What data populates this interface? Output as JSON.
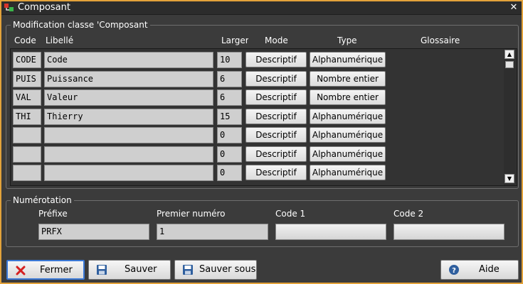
{
  "window": {
    "title": "Composant"
  },
  "grid_group": {
    "title": "Modification classe 'Composant"
  },
  "columns": {
    "code": "Code",
    "libelle": "Libellé",
    "largeur": "Larger",
    "mode": "Mode",
    "type": "Type",
    "glossaire": "Glossaire"
  },
  "rows": [
    {
      "code": "CODE",
      "libelle": "Code",
      "largeur": "10",
      "mode": "Descriptif",
      "type": "Alphanumérique"
    },
    {
      "code": "PUIS",
      "libelle": "Puissance",
      "largeur": "6",
      "mode": "Descriptif",
      "type": "Nombre entier"
    },
    {
      "code": "VAL",
      "libelle": "Valeur",
      "largeur": "6",
      "mode": "Descriptif",
      "type": "Nombre entier"
    },
    {
      "code": "THI",
      "libelle": "Thierry",
      "largeur": "15",
      "mode": "Descriptif",
      "type": "Alphanumérique"
    },
    {
      "code": "",
      "libelle": "",
      "largeur": "0",
      "mode": "Descriptif",
      "type": "Alphanumérique"
    },
    {
      "code": "",
      "libelle": "",
      "largeur": "0",
      "mode": "Descriptif",
      "type": "Alphanumérique"
    },
    {
      "code": "",
      "libelle": "",
      "largeur": "0",
      "mode": "Descriptif",
      "type": "Alphanumérique"
    }
  ],
  "numerotation": {
    "title": "Numérotation",
    "prefixe_label": "Préfixe",
    "prefixe_value": "PRFX",
    "premier_label": "Premier numéro",
    "premier_value": "1",
    "code1_label": "Code 1",
    "code1_value": "",
    "code2_label": "Code 2",
    "code2_value": ""
  },
  "footer": {
    "fermer": "Fermer",
    "sauver": "Sauver",
    "sauver_sous": "Sauver sous",
    "aide": "Aide"
  },
  "colors": {
    "accent_border": "#e3a23a",
    "focus": "#3a78d6",
    "close_red": "#d42020"
  }
}
